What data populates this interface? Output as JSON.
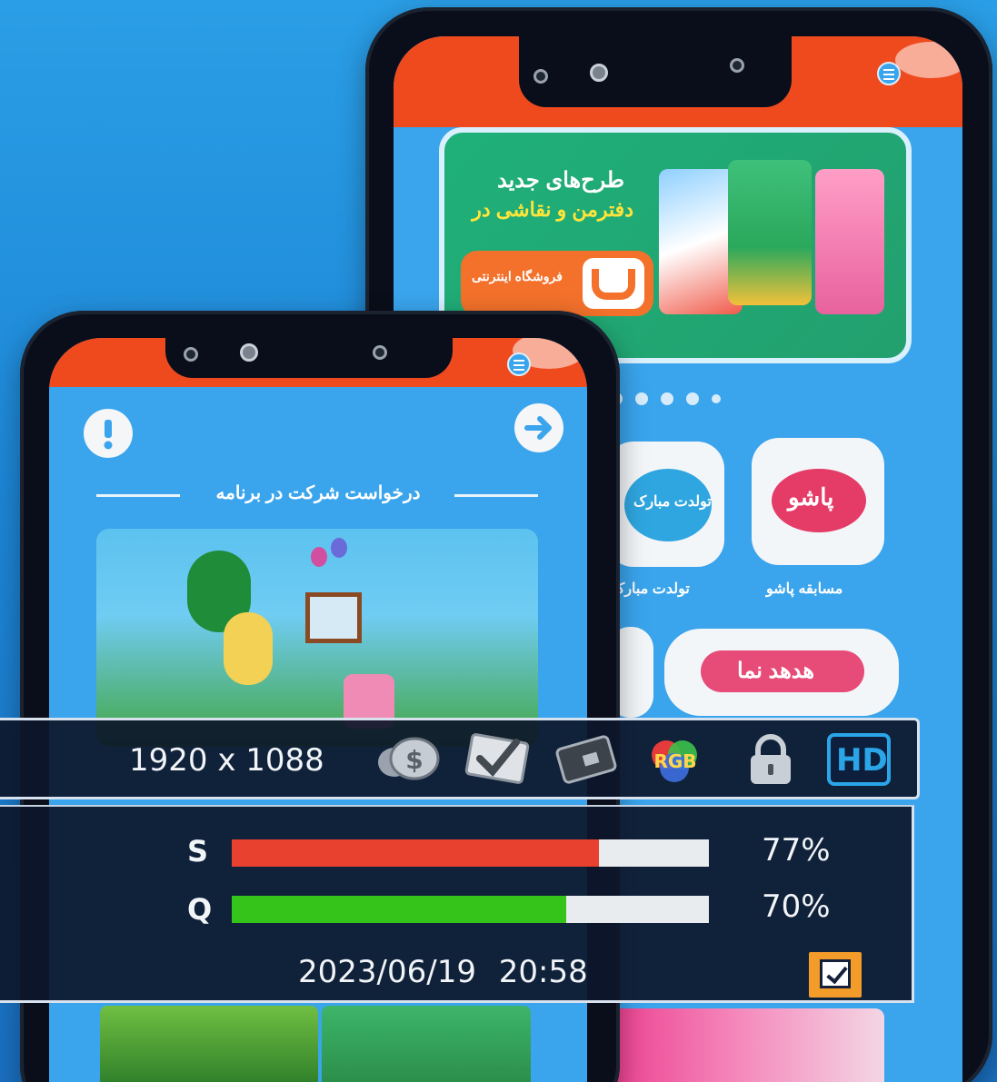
{
  "back_phone": {
    "banner": {
      "title": "طرح‌های جدید",
      "subtitle": "دفترمن و نقاشی در",
      "shop_label": "فروشگاه اینترنتی"
    },
    "carousel_dots": 5,
    "apps": [
      {
        "logo_text": "تولدت مبارک",
        "label": "تولدت مبارک"
      },
      {
        "logo_text": "پاشو",
        "label": "مسابقه پاشو"
      },
      {
        "logo_text": "هدهد نما",
        "label": ""
      }
    ]
  },
  "front_phone": {
    "section_title": "درخواست شرکت در برنامه"
  },
  "osd": {
    "resolution": "1920 x 1088",
    "icons": [
      "dollar-coin-icon",
      "checked-card-icon",
      "scrambled-card-icon",
      "rgb-icon",
      "lock-icon",
      "hd-icon"
    ],
    "hd_label": "HD",
    "rgb_label": "RGB",
    "signal": {
      "label": "S",
      "percent_text": "77%",
      "level": 0.77,
      "color": "#e8412f"
    },
    "quality": {
      "label": "Q",
      "percent_text": "70%",
      "level": 0.7,
      "color": "#35c419"
    },
    "date": "2023/06/19",
    "time": "20:58"
  }
}
